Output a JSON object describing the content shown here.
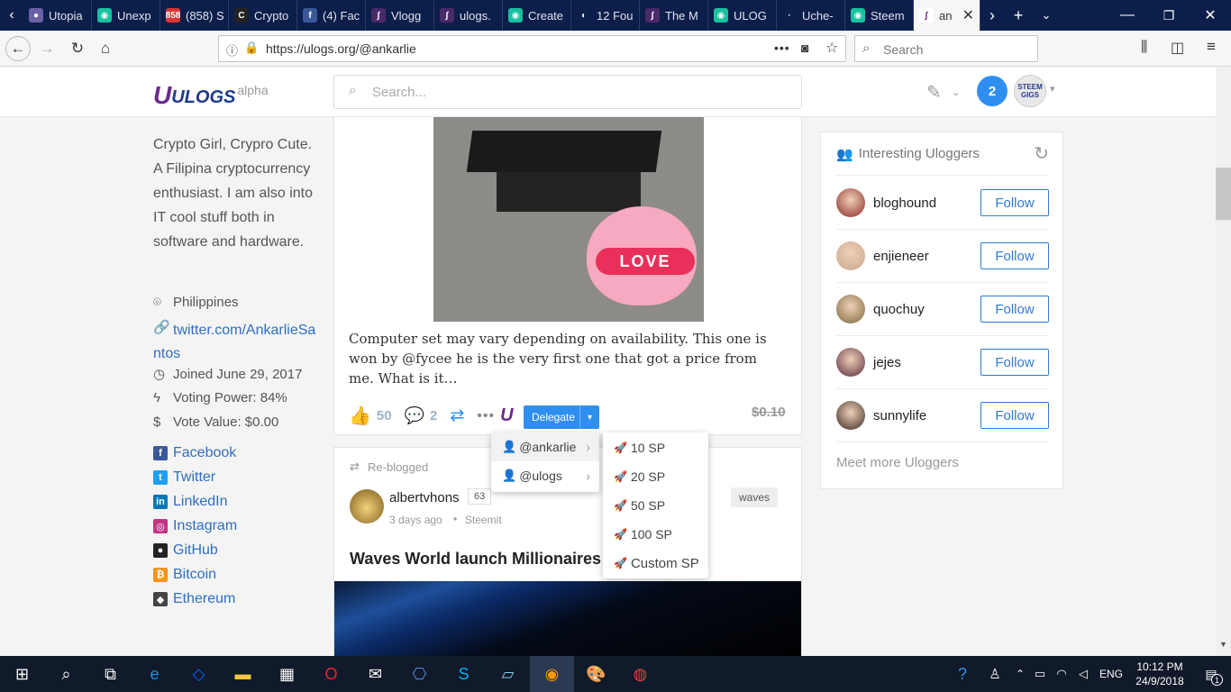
{
  "browser": {
    "tabs": [
      {
        "label": "Utopia",
        "color": "#6b5fa8",
        "glyph": "●"
      },
      {
        "label": "Unexp",
        "color": "#18c1a0",
        "glyph": "◉"
      },
      {
        "label": "(858) S",
        "color": "#d33",
        "glyph": "858"
      },
      {
        "label": "Crypto",
        "color": "#222",
        "glyph": "C"
      },
      {
        "label": "(4) Fac",
        "color": "#3b5998",
        "glyph": "f"
      },
      {
        "label": "Vlogg",
        "color": "#4b2a6a",
        "glyph": "∫"
      },
      {
        "label": "ulogs.",
        "color": "#4b2a6a",
        "glyph": "∫"
      },
      {
        "label": "Create",
        "color": "#18c1a0",
        "glyph": "◉"
      },
      {
        "label": "12 Fou",
        "color": "#0c1e4a",
        "glyph": "◐"
      },
      {
        "label": "The M",
        "color": "#4b2a6a",
        "glyph": "∫"
      },
      {
        "label": "ULOG",
        "color": "#18c1a0",
        "glyph": "◉"
      },
      {
        "label": "Uche-",
        "color": "#0c1e4a",
        "glyph": "·"
      },
      {
        "label": "Steem",
        "color": "#18c1a0",
        "glyph": "◉"
      }
    ],
    "active_tab": {
      "label": "an",
      "close": "✕"
    },
    "url": "https://ulogs.org/@ankarlie",
    "search_placeholder": "Search",
    "page_actions": "•••"
  },
  "site": {
    "logo_text": "ULOGS",
    "logo_suffix": "alpha",
    "search_placeholder": "Search...",
    "notification_count": "2",
    "avatar_label": "STEEM GIGS"
  },
  "profile": {
    "bio": "Crypto Girl, Crypro Cute. A Filipina cryptocurrency enthusiast. I am also into IT cool stuff both in software and hardware.",
    "location": "Philippines",
    "website_line1": "twitter.com/AnkarlieSa",
    "website_line2": "ntos",
    "joined": "Joined June 29, 2017",
    "voting_power": "Voting Power: 84%",
    "vote_value": "Vote Value: $0.00",
    "links": [
      {
        "label": "Facebook",
        "color": "#3b5998",
        "glyph": "f"
      },
      {
        "label": "Twitter",
        "color": "#1da1f2",
        "glyph": "t"
      },
      {
        "label": "LinkedIn",
        "color": "#0077b5",
        "glyph": "in"
      },
      {
        "label": "Instagram",
        "color": "#c13584",
        "glyph": "◎"
      },
      {
        "label": "GitHub",
        "color": "#222",
        "glyph": "●"
      },
      {
        "label": "Bitcoin",
        "color": "#f7931a",
        "glyph": "₿"
      },
      {
        "label": "Ethereum",
        "color": "#444",
        "glyph": "◆"
      }
    ]
  },
  "post1": {
    "image_text": "LOVE",
    "excerpt": "Computer set may vary depending on availability. This one is won by @fycee he is the very first one that got a price from me. What is it…",
    "likes": "50",
    "comments": "2",
    "delegate_label": "Delegate",
    "payout": "$0.10"
  },
  "delegate_menu": {
    "accounts": [
      "@ankarlie",
      "@ulogs"
    ],
    "amounts": [
      "10 SP",
      "20 SP",
      "50 SP",
      "100 SP",
      "Custom SP"
    ]
  },
  "post2": {
    "reblogged_label": "Re-blogged",
    "author": "albertvhons",
    "reputation": "63",
    "time": "3 days ago",
    "source": "Steemit",
    "tag": "waves",
    "title": "Waves World launch Millionaires"
  },
  "uloggers": {
    "title": "Interesting Uloggers",
    "follow_label": "Follow",
    "users": [
      {
        "name": "bloghound",
        "color": "#8b2a2a"
      },
      {
        "name": "enjieneer",
        "color": "#c9a78a"
      },
      {
        "name": "quochuy",
        "color": "#7a6a3a"
      },
      {
        "name": "jejes",
        "color": "#5a2a3a"
      },
      {
        "name": "sunnylife",
        "color": "#3a2a22"
      }
    ],
    "more_label": "Meet more Uloggers"
  },
  "taskbar": {
    "time": "10:12 PM",
    "date": "24/9/2018",
    "lang": "ENG",
    "notif_count": "1"
  }
}
